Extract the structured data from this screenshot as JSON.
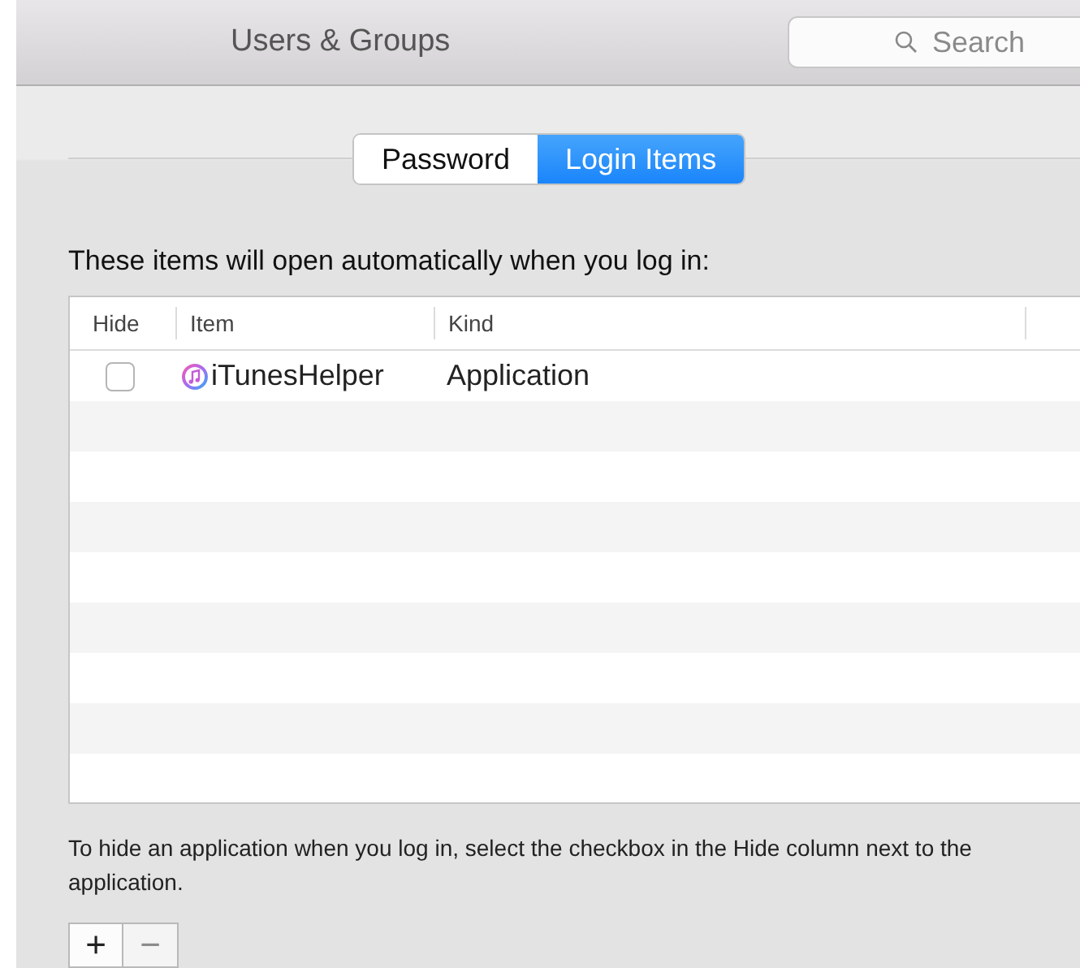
{
  "window": {
    "title": "Users & Groups"
  },
  "search": {
    "placeholder": "Search"
  },
  "tabs": [
    {
      "label": "Password",
      "selected": false
    },
    {
      "label": "Login Items",
      "selected": true
    }
  ],
  "intro": "These items will open automatically when you log in:",
  "table": {
    "columns": [
      "Hide",
      "Item",
      "Kind"
    ],
    "rows": [
      {
        "hide": false,
        "item": "iTunesHelper",
        "kind": "Application"
      }
    ]
  },
  "note": "To hide an application when you log in, select the checkbox in the Hide column next to the application.",
  "buttons": [
    {
      "label": "+",
      "disabled": false
    },
    {
      "label": "−",
      "disabled": true
    }
  ]
}
